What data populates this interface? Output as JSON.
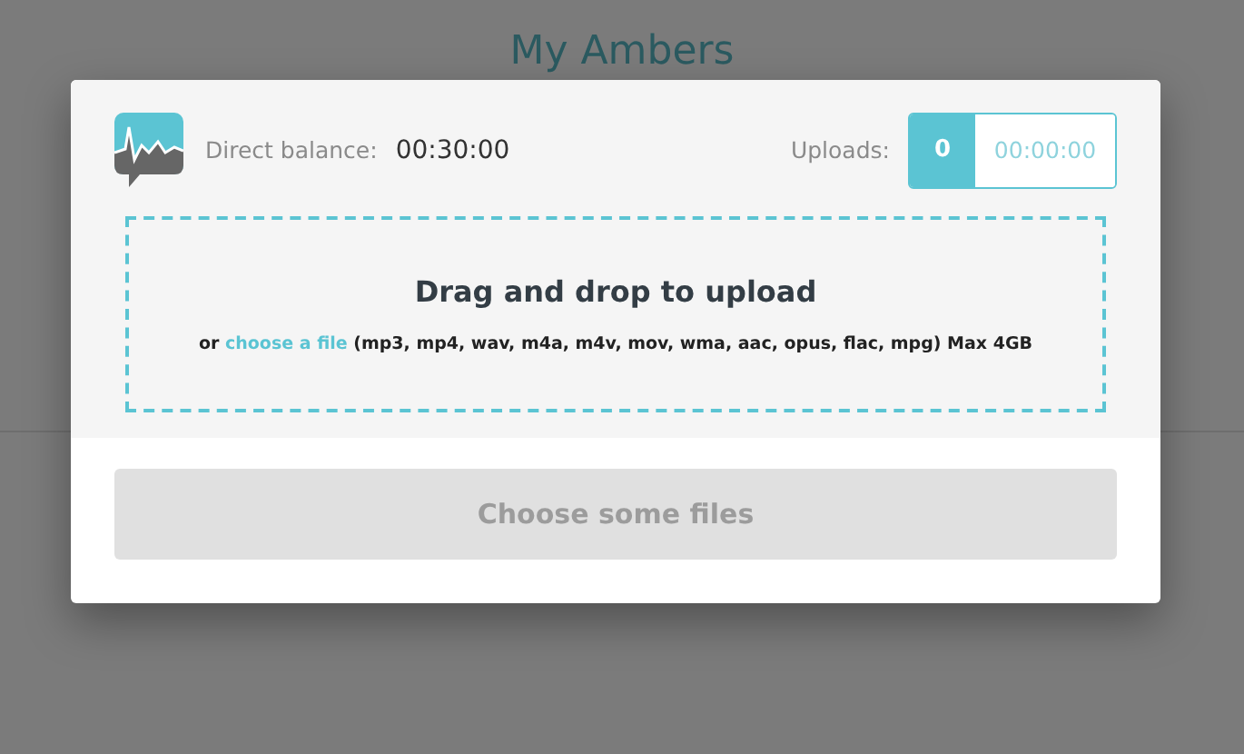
{
  "page": {
    "title": "My Ambers"
  },
  "dialog": {
    "balance_label": "Direct balance:",
    "balance_value": "00:30:00",
    "uploads_label": "Uploads:",
    "uploads_count": "0",
    "uploads_time": "00:00:00",
    "dropzone": {
      "heading": "Drag and drop to upload",
      "prefix": "or",
      "link": "choose a file",
      "suffix": "(mp3, mp4, wav, m4a, m4v, mov, wma, aac, opus, flac, mpg) Max 4GB"
    },
    "button": {
      "label": "Choose some files",
      "disabled": true
    }
  }
}
